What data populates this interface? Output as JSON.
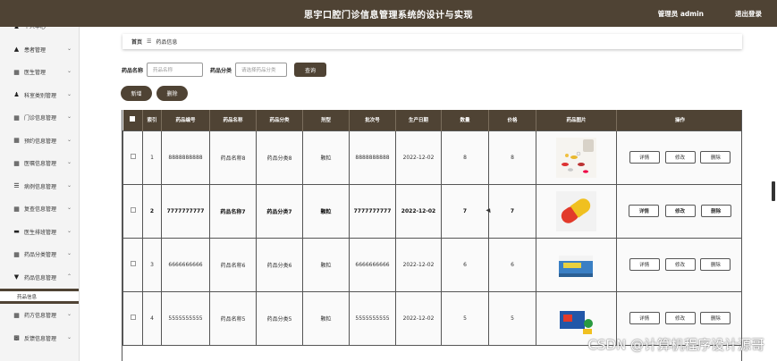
{
  "header": {
    "title": "思宇口腔门诊信息管理系统的设计与实现",
    "user_label": "管理员 admin",
    "logout_label": "退出登录"
  },
  "sidebar": {
    "items": [
      {
        "label": "个人中心",
        "icon": "user-icon"
      },
      {
        "label": "患者管理",
        "icon": "thumb-icon"
      },
      {
        "label": "医生管理",
        "icon": "grid-icon"
      },
      {
        "label": "科室类别管理",
        "icon": "user-icon"
      },
      {
        "label": "门诊信息管理",
        "icon": "grid-icon"
      },
      {
        "label": "预约信息管理",
        "icon": "grid-icon"
      },
      {
        "label": "医嘱信息管理",
        "icon": "grid-icon"
      },
      {
        "label": "病例信息管理",
        "icon": "sliders-icon"
      },
      {
        "label": "复查信息管理",
        "icon": "grid-icon"
      },
      {
        "label": "医生排班管理",
        "icon": "ticket-icon"
      },
      {
        "label": "药品分类管理",
        "icon": "grid-icon"
      },
      {
        "label": "药品信息管理",
        "icon": "filter-icon",
        "expanded": true,
        "children": [
          "药品信息"
        ]
      },
      {
        "label": "药方信息管理",
        "icon": "grid-icon"
      },
      {
        "label": "反馈信息管理",
        "icon": "chart-icon"
      }
    ]
  },
  "breadcrumb": {
    "home": "首页",
    "separator": "☰",
    "current": "药品信息"
  },
  "search": {
    "name_label": "药品名称",
    "name_placeholder": "药品名称",
    "category_label": "药品分类",
    "category_placeholder": "请选择药品分类",
    "search_button": "查询"
  },
  "actions": {
    "add": "新增",
    "delete": "删除"
  },
  "table": {
    "columns": [
      "索引",
      "药品编号",
      "药品名称",
      "药品分类",
      "剂型",
      "批次号",
      "生产日期",
      "数量",
      "价格",
      "药品图片",
      "操作"
    ],
    "rows": [
      {
        "index": "1",
        "code": "8888888888",
        "name": "药品名称8",
        "category": "药品分类8",
        "form": "颗粒",
        "batch": "8888888888",
        "date": "2022-12-02",
        "qty": "8",
        "price": "8",
        "image": "pills-scatter"
      },
      {
        "index": "2",
        "code": "7777777777",
        "name": "药品名称7",
        "category": "药品分类7",
        "form": "颗粒",
        "batch": "7777777777",
        "date": "2022-12-02",
        "qty": "7",
        "price": "7",
        "image": "capsule"
      },
      {
        "index": "3",
        "code": "6666666666",
        "name": "药品名称6",
        "category": "药品分类6",
        "form": "颗粒",
        "batch": "6666666666",
        "date": "2022-12-02",
        "qty": "6",
        "price": "6",
        "image": "medicine-box"
      },
      {
        "index": "4",
        "code": "5555555555",
        "name": "药品名称5",
        "category": "药品分类5",
        "form": "颗粒",
        "batch": "5555555555",
        "date": "2022-12-02",
        "qty": "5",
        "price": "5",
        "image": "medicine-pack"
      }
    ],
    "op_labels": {
      "detail": "详情",
      "edit": "修改",
      "delete": "删除"
    }
  },
  "watermark": "CSDN @计算机程序设计源哥",
  "colors": {
    "brand": "#4f4334",
    "header_text": "#ffffff"
  }
}
